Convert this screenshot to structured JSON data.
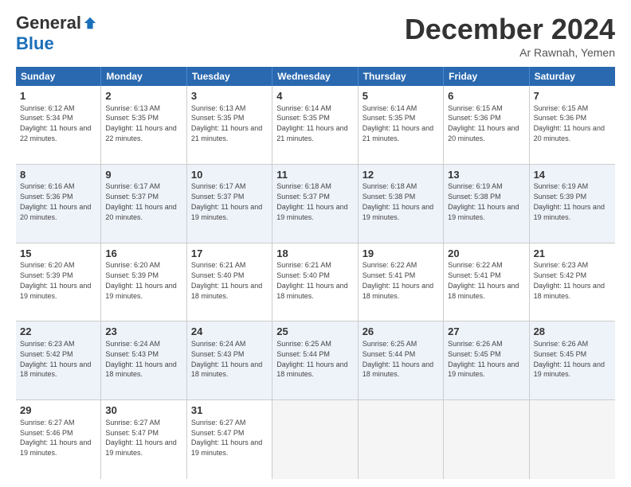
{
  "logo": {
    "general": "General",
    "blue": "Blue"
  },
  "header": {
    "month": "December 2024",
    "location": "Ar Rawnah, Yemen"
  },
  "days": [
    "Sunday",
    "Monday",
    "Tuesday",
    "Wednesday",
    "Thursday",
    "Friday",
    "Saturday"
  ],
  "weeks": [
    [
      {
        "day": "1",
        "sunrise": "Sunrise: 6:12 AM",
        "sunset": "Sunset: 5:34 PM",
        "daylight": "Daylight: 11 hours and 22 minutes."
      },
      {
        "day": "2",
        "sunrise": "Sunrise: 6:13 AM",
        "sunset": "Sunset: 5:35 PM",
        "daylight": "Daylight: 11 hours and 22 minutes."
      },
      {
        "day": "3",
        "sunrise": "Sunrise: 6:13 AM",
        "sunset": "Sunset: 5:35 PM",
        "daylight": "Daylight: 11 hours and 21 minutes."
      },
      {
        "day": "4",
        "sunrise": "Sunrise: 6:14 AM",
        "sunset": "Sunset: 5:35 PM",
        "daylight": "Daylight: 11 hours and 21 minutes."
      },
      {
        "day": "5",
        "sunrise": "Sunrise: 6:14 AM",
        "sunset": "Sunset: 5:35 PM",
        "daylight": "Daylight: 11 hours and 21 minutes."
      },
      {
        "day": "6",
        "sunrise": "Sunrise: 6:15 AM",
        "sunset": "Sunset: 5:36 PM",
        "daylight": "Daylight: 11 hours and 20 minutes."
      },
      {
        "day": "7",
        "sunrise": "Sunrise: 6:15 AM",
        "sunset": "Sunset: 5:36 PM",
        "daylight": "Daylight: 11 hours and 20 minutes."
      }
    ],
    [
      {
        "day": "8",
        "sunrise": "Sunrise: 6:16 AM",
        "sunset": "Sunset: 5:36 PM",
        "daylight": "Daylight: 11 hours and 20 minutes."
      },
      {
        "day": "9",
        "sunrise": "Sunrise: 6:17 AM",
        "sunset": "Sunset: 5:37 PM",
        "daylight": "Daylight: 11 hours and 20 minutes."
      },
      {
        "day": "10",
        "sunrise": "Sunrise: 6:17 AM",
        "sunset": "Sunset: 5:37 PM",
        "daylight": "Daylight: 11 hours and 19 minutes."
      },
      {
        "day": "11",
        "sunrise": "Sunrise: 6:18 AM",
        "sunset": "Sunset: 5:37 PM",
        "daylight": "Daylight: 11 hours and 19 minutes."
      },
      {
        "day": "12",
        "sunrise": "Sunrise: 6:18 AM",
        "sunset": "Sunset: 5:38 PM",
        "daylight": "Daylight: 11 hours and 19 minutes."
      },
      {
        "day": "13",
        "sunrise": "Sunrise: 6:19 AM",
        "sunset": "Sunset: 5:38 PM",
        "daylight": "Daylight: 11 hours and 19 minutes."
      },
      {
        "day": "14",
        "sunrise": "Sunrise: 6:19 AM",
        "sunset": "Sunset: 5:39 PM",
        "daylight": "Daylight: 11 hours and 19 minutes."
      }
    ],
    [
      {
        "day": "15",
        "sunrise": "Sunrise: 6:20 AM",
        "sunset": "Sunset: 5:39 PM",
        "daylight": "Daylight: 11 hours and 19 minutes."
      },
      {
        "day": "16",
        "sunrise": "Sunrise: 6:20 AM",
        "sunset": "Sunset: 5:39 PM",
        "daylight": "Daylight: 11 hours and 19 minutes."
      },
      {
        "day": "17",
        "sunrise": "Sunrise: 6:21 AM",
        "sunset": "Sunset: 5:40 PM",
        "daylight": "Daylight: 11 hours and 18 minutes."
      },
      {
        "day": "18",
        "sunrise": "Sunrise: 6:21 AM",
        "sunset": "Sunset: 5:40 PM",
        "daylight": "Daylight: 11 hours and 18 minutes."
      },
      {
        "day": "19",
        "sunrise": "Sunrise: 6:22 AM",
        "sunset": "Sunset: 5:41 PM",
        "daylight": "Daylight: 11 hours and 18 minutes."
      },
      {
        "day": "20",
        "sunrise": "Sunrise: 6:22 AM",
        "sunset": "Sunset: 5:41 PM",
        "daylight": "Daylight: 11 hours and 18 minutes."
      },
      {
        "day": "21",
        "sunrise": "Sunrise: 6:23 AM",
        "sunset": "Sunset: 5:42 PM",
        "daylight": "Daylight: 11 hours and 18 minutes."
      }
    ],
    [
      {
        "day": "22",
        "sunrise": "Sunrise: 6:23 AM",
        "sunset": "Sunset: 5:42 PM",
        "daylight": "Daylight: 11 hours and 18 minutes."
      },
      {
        "day": "23",
        "sunrise": "Sunrise: 6:24 AM",
        "sunset": "Sunset: 5:43 PM",
        "daylight": "Daylight: 11 hours and 18 minutes."
      },
      {
        "day": "24",
        "sunrise": "Sunrise: 6:24 AM",
        "sunset": "Sunset: 5:43 PM",
        "daylight": "Daylight: 11 hours and 18 minutes."
      },
      {
        "day": "25",
        "sunrise": "Sunrise: 6:25 AM",
        "sunset": "Sunset: 5:44 PM",
        "daylight": "Daylight: 11 hours and 18 minutes."
      },
      {
        "day": "26",
        "sunrise": "Sunrise: 6:25 AM",
        "sunset": "Sunset: 5:44 PM",
        "daylight": "Daylight: 11 hours and 18 minutes."
      },
      {
        "day": "27",
        "sunrise": "Sunrise: 6:26 AM",
        "sunset": "Sunset: 5:45 PM",
        "daylight": "Daylight: 11 hours and 19 minutes."
      },
      {
        "day": "28",
        "sunrise": "Sunrise: 6:26 AM",
        "sunset": "Sunset: 5:45 PM",
        "daylight": "Daylight: 11 hours and 19 minutes."
      }
    ],
    [
      {
        "day": "29",
        "sunrise": "Sunrise: 6:27 AM",
        "sunset": "Sunset: 5:46 PM",
        "daylight": "Daylight: 11 hours and 19 minutes."
      },
      {
        "day": "30",
        "sunrise": "Sunrise: 6:27 AM",
        "sunset": "Sunset: 5:47 PM",
        "daylight": "Daylight: 11 hours and 19 minutes."
      },
      {
        "day": "31",
        "sunrise": "Sunrise: 6:27 AM",
        "sunset": "Sunset: 5:47 PM",
        "daylight": "Daylight: 11 hours and 19 minutes."
      },
      {
        "day": "",
        "sunrise": "",
        "sunset": "",
        "daylight": ""
      },
      {
        "day": "",
        "sunrise": "",
        "sunset": "",
        "daylight": ""
      },
      {
        "day": "",
        "sunrise": "",
        "sunset": "",
        "daylight": ""
      },
      {
        "day": "",
        "sunrise": "",
        "sunset": "",
        "daylight": ""
      }
    ]
  ]
}
